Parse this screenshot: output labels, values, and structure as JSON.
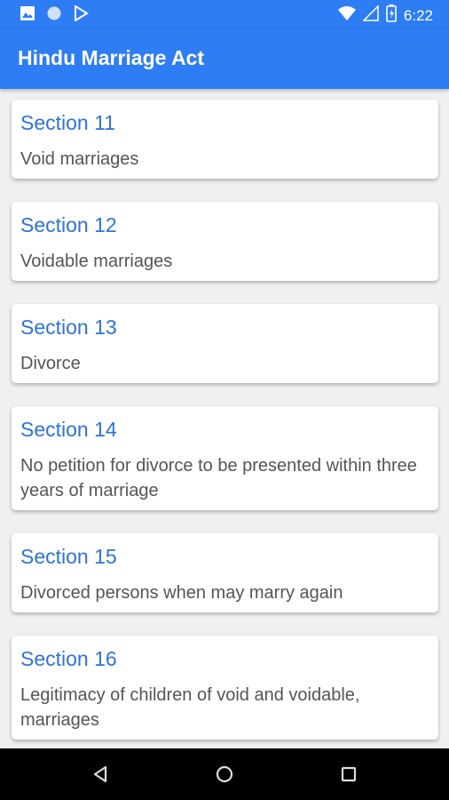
{
  "status_bar": {
    "time": "6:22",
    "icons_left": [
      "image-icon",
      "circle-icon",
      "play-store-icon"
    ],
    "icons_right": [
      "wifi-icon",
      "signal-icon",
      "battery-icon"
    ]
  },
  "app_bar": {
    "title": "Hindu Marriage Act"
  },
  "sections": [
    {
      "title": "Section 11",
      "description": "Void marriages"
    },
    {
      "title": "Section 12",
      "description": "Voidable marriages"
    },
    {
      "title": "Section 13",
      "description": "Divorce"
    },
    {
      "title": "Section 14",
      "description": "No petition for divorce to be presented within three years of marriage"
    },
    {
      "title": "Section 15",
      "description": "Divorced persons when may marry again"
    },
    {
      "title": "Section 16",
      "description": "Legitimacy of children of void and voidable, marriages"
    }
  ],
  "nav_bar": {
    "buttons": [
      "back-icon",
      "home-icon",
      "recents-icon"
    ]
  },
  "colors": {
    "primary": "#2e7df5",
    "section_title": "#2f73d8",
    "description": "#555555",
    "background": "#f0f0f0"
  }
}
